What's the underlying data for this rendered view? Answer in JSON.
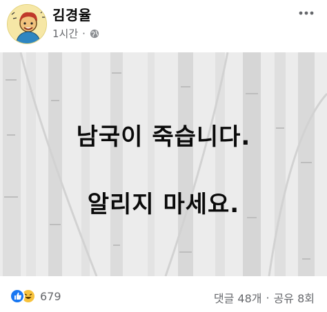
{
  "post": {
    "author": "김경율",
    "time": "1시간",
    "separator": "·",
    "privacy_icon": "globe-icon",
    "more_icon": "more-horizontal-icon"
  },
  "image": {
    "line1": "남국이 죽습니다.",
    "line2": "알리지 마세요."
  },
  "footer": {
    "reaction_icons": [
      "like-icon",
      "haha-icon"
    ],
    "reaction_count": "679",
    "comments": "댓글 48개",
    "separator": "·",
    "shares": "공유 8회"
  },
  "colors": {
    "like": "#1877f2",
    "haha": "#f7c23c",
    "meta_text": "#65676b"
  }
}
